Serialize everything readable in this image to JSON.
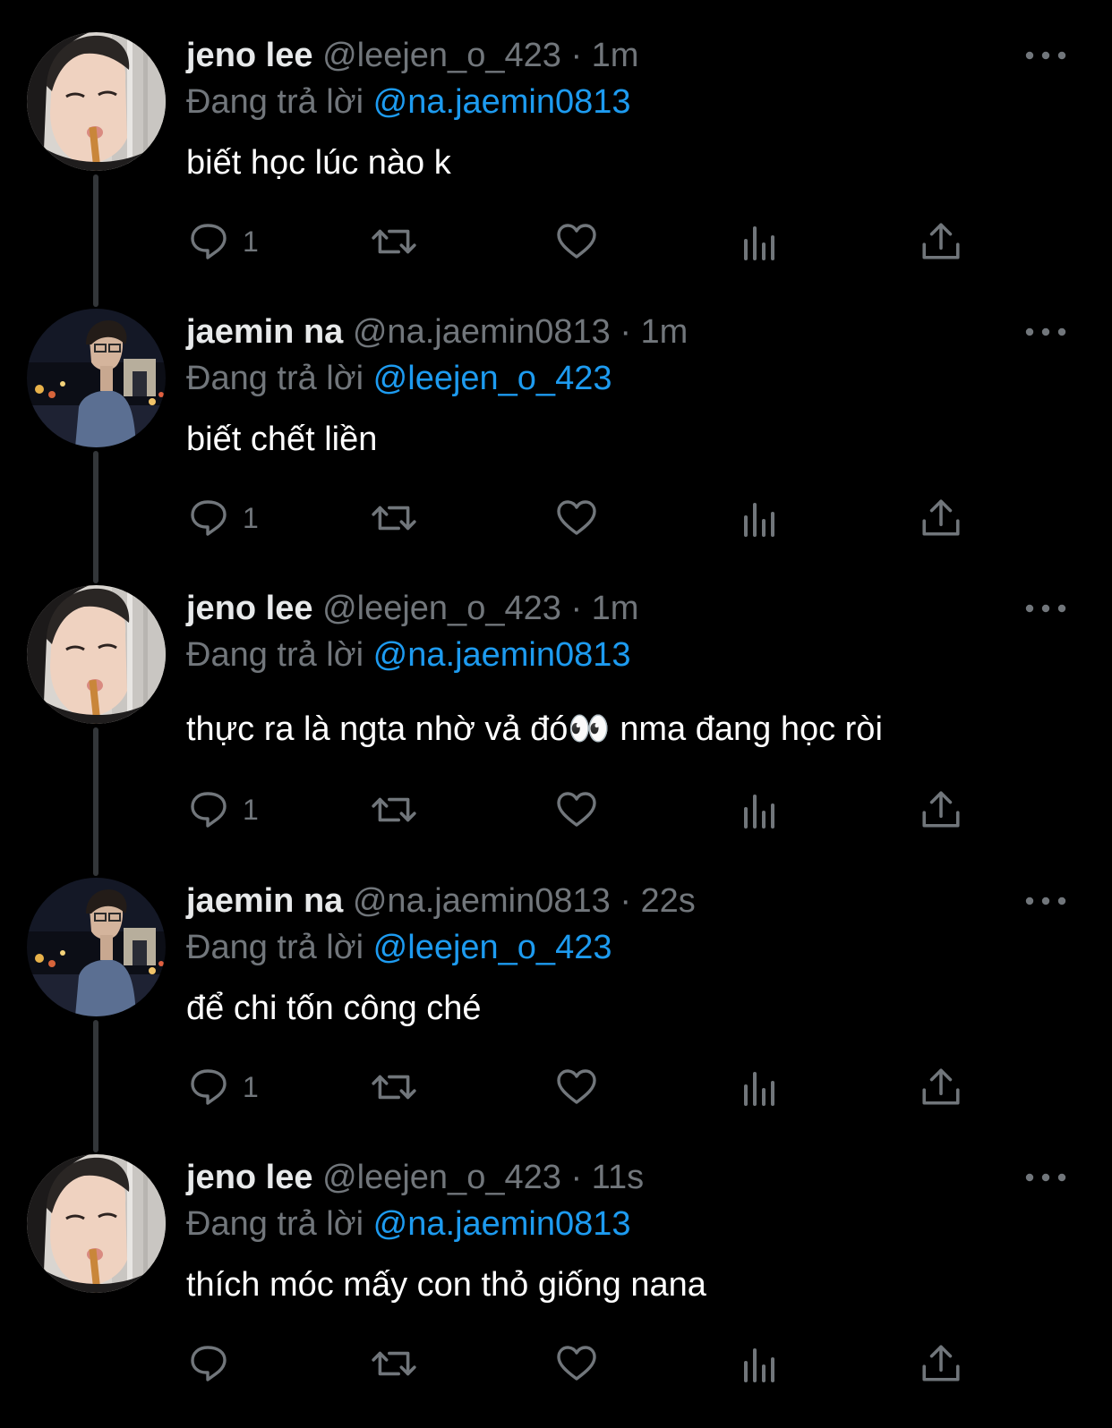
{
  "colors": {
    "background": "#000000",
    "text_primary": "#e7e9ea",
    "text_secondary": "#71767b",
    "link": "#1d9bf0",
    "thread_line": "#333639"
  },
  "reply_prefix": "Đang trả lời",
  "dot": "·",
  "icons": {
    "more": "more-horizontal-icon",
    "reply": "reply-bubble-icon",
    "retweet": "retweet-icon",
    "like": "heart-icon",
    "views": "views-bar-icon",
    "share": "share-upload-icon"
  },
  "tweets": [
    {
      "name": "jeno lee",
      "handle": "@leejen_o_423",
      "time": "1m",
      "reply_to": "@na.jaemin0813",
      "text": "biết học lúc nào k",
      "reply_count": "1",
      "avatar": "jeno-lee-avatar"
    },
    {
      "name": "jaemin na",
      "handle": "@na.jaemin0813",
      "time": "1m",
      "reply_to": "@leejen_o_423",
      "text": "biết chết liền",
      "reply_count": "1",
      "avatar": "jaemin-na-avatar"
    },
    {
      "name": "jeno lee",
      "handle": "@leejen_o_423",
      "time": "1m",
      "reply_to": "@na.jaemin0813",
      "text": "thực ra là ngta nhờ vả đó👀  nma đang học ròi",
      "reply_count": "1",
      "avatar": "jeno-lee-avatar"
    },
    {
      "name": "jaemin na",
      "handle": "@na.jaemin0813",
      "time": "22s",
      "reply_to": "@leejen_o_423",
      "text": "để chi tốn công ché",
      "reply_count": "1",
      "avatar": "jaemin-na-avatar"
    },
    {
      "name": "jeno lee",
      "handle": "@leejen_o_423",
      "time": "11s",
      "reply_to": "@na.jaemin0813",
      "text": "thích móc mấy con thỏ giống nana",
      "reply_count": "",
      "avatar": "jeno-lee-avatar"
    }
  ]
}
